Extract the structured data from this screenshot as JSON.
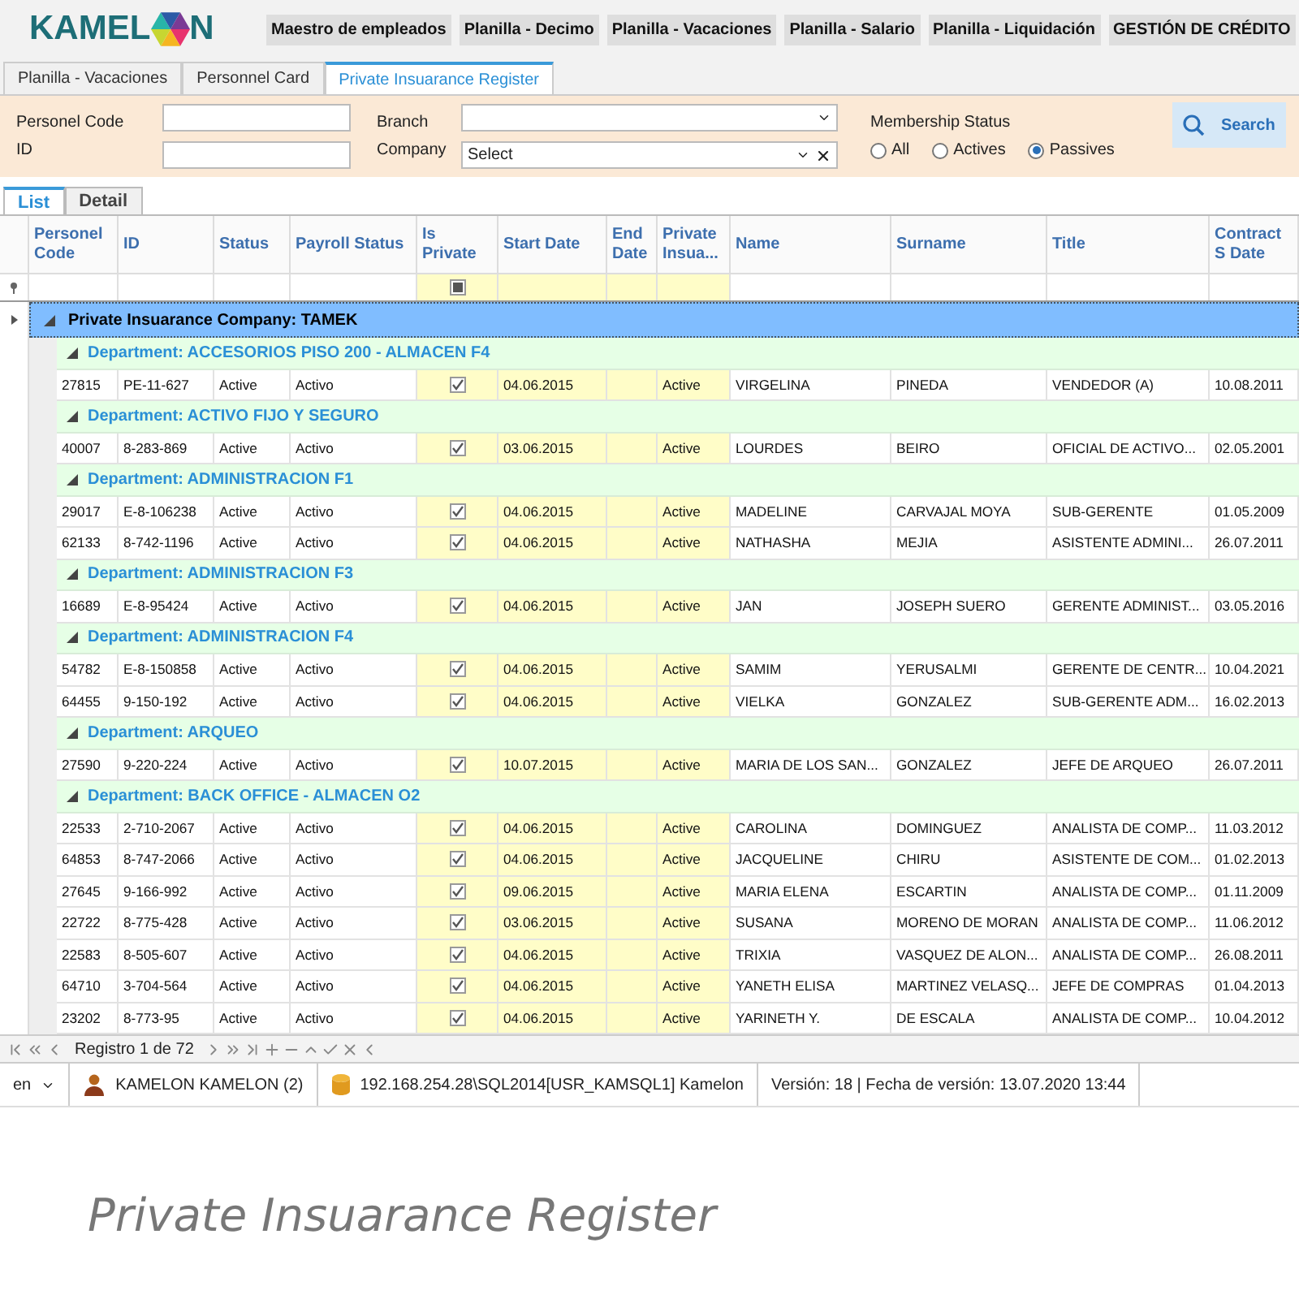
{
  "logo": {
    "text_before": "KAMEL",
    "text_after": "N"
  },
  "main_menu": [
    "Maestro de empleados",
    "Planilla - Decimo",
    "Planilla - Vacaciones",
    "Planilla - Salario",
    "Planilla - Liquidación",
    "GESTIÓN DE CRÉDITO"
  ],
  "document_tabs": [
    {
      "label": "Planilla - Vacaciones",
      "selected": false
    },
    {
      "label": "Personnel Card",
      "selected": false
    },
    {
      "label": "Private Insuarance Register",
      "selected": true
    }
  ],
  "filters": {
    "personel_code_label": "Personel Code",
    "id_label": "ID",
    "branch_label": "Branch",
    "company_label": "Company",
    "company_value": "Select",
    "membership_label": "Membership Status",
    "membership_options": [
      {
        "label": "All",
        "selected": false
      },
      {
        "label": "Actives",
        "selected": false
      },
      {
        "label": "Passives",
        "selected": true
      }
    ],
    "search_button": "Search"
  },
  "view_tabs": [
    {
      "label": "List",
      "selected": true
    },
    {
      "label": "Detail",
      "selected": false
    }
  ],
  "columns": [
    "Personel Code",
    "ID",
    "Status",
    "Payroll Status",
    "Is Private",
    "Start Date",
    "End Date",
    "Private Insua...",
    "Name",
    "Surname",
    "Title",
    "Contract S Date"
  ],
  "is_private_filter": {
    "indeterminate": true
  },
  "company_group": {
    "label": "Private Insuarance Company: TAMEK",
    "expanded": true
  },
  "groups": [
    {
      "label": "Department: ACCESORIOS PISO 200 - ALMACEN F4",
      "expanded": true,
      "rows": [
        {
          "code": "27815",
          "id": "PE-11-627",
          "status": "Active",
          "payroll_status": "Activo",
          "is_private": true,
          "start_date": "04.06.2015",
          "private_insurance": "Active",
          "name": "VIRGELINA",
          "surname": "PINEDA",
          "title": "VENDEDOR (A)",
          "contract_start": "10.08.2011"
        }
      ]
    },
    {
      "label": "Department: ACTIVO FIJO Y SEGURO",
      "expanded": true,
      "rows": [
        {
          "code": "40007",
          "id": "8-283-869",
          "status": "Active",
          "payroll_status": "Activo",
          "is_private": true,
          "start_date": "03.06.2015",
          "private_insurance": "Active",
          "name": "LOURDES",
          "surname": "BEIRO",
          "title": "OFICIAL DE ACTIVO...",
          "contract_start": "02.05.2001"
        }
      ]
    },
    {
      "label": "Department: ADMINISTRACION F1",
      "expanded": true,
      "rows": [
        {
          "code": "29017",
          "id": "E-8-106238",
          "status": "Active",
          "payroll_status": "Activo",
          "is_private": true,
          "start_date": "04.06.2015",
          "private_insurance": "Active",
          "name": "MADELINE",
          "surname": "CARVAJAL MOYA",
          "title": "SUB-GERENTE",
          "contract_start": "01.05.2009"
        },
        {
          "code": "62133",
          "id": "8-742-1196",
          "status": "Active",
          "payroll_status": "Activo",
          "is_private": true,
          "start_date": "04.06.2015",
          "private_insurance": "Active",
          "name": "NATHASHA",
          "surname": "MEJIA",
          "title": "ASISTENTE ADMINI...",
          "contract_start": "26.07.2011"
        }
      ]
    },
    {
      "label": "Department: ADMINISTRACION F3",
      "expanded": true,
      "rows": [
        {
          "code": "16689",
          "id": "E-8-95424",
          "status": "Active",
          "payroll_status": "Activo",
          "is_private": true,
          "start_date": "04.06.2015",
          "private_insurance": "Active",
          "name": "JAN",
          "surname": "JOSEPH SUERO",
          "title": "GERENTE ADMINIST...",
          "contract_start": "03.05.2016"
        }
      ]
    },
    {
      "label": "Department: ADMINISTRACION F4",
      "expanded": true,
      "rows": [
        {
          "code": "54782",
          "id": "E-8-150858",
          "status": "Active",
          "payroll_status": "Activo",
          "is_private": true,
          "start_date": "04.06.2015",
          "private_insurance": "Active",
          "name": "SAMIM",
          "surname": "YERUSALMI",
          "title": "GERENTE DE CENTR...",
          "contract_start": "10.04.2021"
        },
        {
          "code": "64455",
          "id": "9-150-192",
          "status": "Active",
          "payroll_status": "Activo",
          "is_private": true,
          "start_date": "04.06.2015",
          "private_insurance": "Active",
          "name": "VIELKA",
          "surname": "GONZALEZ",
          "title": "SUB-GERENTE ADM...",
          "contract_start": "16.02.2013"
        }
      ]
    },
    {
      "label": "Department: ARQUEO",
      "expanded": true,
      "rows": [
        {
          "code": "27590",
          "id": "9-220-224",
          "status": "Active",
          "payroll_status": "Activo",
          "is_private": true,
          "start_date": "10.07.2015",
          "private_insurance": "Active",
          "name": "MARIA DE LOS SAN...",
          "surname": "GONZALEZ",
          "title": "JEFE DE ARQUEO",
          "contract_start": "26.07.2011"
        }
      ]
    },
    {
      "label": "Department: BACK OFFICE - ALMACEN O2",
      "expanded": true,
      "rows": [
        {
          "code": "22533",
          "id": "2-710-2067",
          "status": "Active",
          "payroll_status": "Activo",
          "is_private": true,
          "start_date": "04.06.2015",
          "private_insurance": "Active",
          "name": "CAROLINA",
          "surname": "DOMINGUEZ",
          "title": "ANALISTA DE COMP...",
          "contract_start": "11.03.2012"
        },
        {
          "code": "64853",
          "id": "8-747-2066",
          "status": "Active",
          "payroll_status": "Activo",
          "is_private": true,
          "start_date": "04.06.2015",
          "private_insurance": "Active",
          "name": "JACQUELINE",
          "surname": "CHIRU",
          "title": "ASISTENTE DE COM...",
          "contract_start": "01.02.2013"
        },
        {
          "code": "27645",
          "id": "9-166-992",
          "status": "Active",
          "payroll_status": "Activo",
          "is_private": true,
          "start_date": "09.06.2015",
          "private_insurance": "Active",
          "name": "MARIA ELENA",
          "surname": "ESCARTIN",
          "title": "ANALISTA DE COMP...",
          "contract_start": "01.11.2009"
        },
        {
          "code": "22722",
          "id": "8-775-428",
          "status": "Active",
          "payroll_status": "Activo",
          "is_private": true,
          "start_date": "03.06.2015",
          "private_insurance": "Active",
          "name": "SUSANA",
          "surname": "MORENO DE MORAN",
          "title": "ANALISTA DE COMP...",
          "contract_start": "11.06.2012"
        },
        {
          "code": "22583",
          "id": "8-505-607",
          "status": "Active",
          "payroll_status": "Activo",
          "is_private": true,
          "start_date": "04.06.2015",
          "private_insurance": "Active",
          "name": "TRIXIA",
          "surname": "VASQUEZ DE ALON...",
          "title": "ANALISTA DE COMP...",
          "contract_start": "26.08.2011"
        },
        {
          "code": "64710",
          "id": "3-704-564",
          "status": "Active",
          "payroll_status": "Activo",
          "is_private": true,
          "start_date": "04.06.2015",
          "private_insurance": "Active",
          "name": "YANETH ELISA",
          "surname": "MARTINEZ VELASQ...",
          "title": "JEFE DE COMPRAS",
          "contract_start": "01.04.2013"
        },
        {
          "code": "23202",
          "id": "8-773-95",
          "status": "Active",
          "payroll_status": "Activo",
          "is_private": true,
          "start_date": "04.06.2015",
          "private_insurance": "Active",
          "name": "YARINETH Y.",
          "surname": "DE ESCALA",
          "title": "ANALISTA DE COMP...",
          "contract_start": "10.04.2012"
        }
      ]
    }
  ],
  "navigator": {
    "record_text": "Registro 1 de 72"
  },
  "status_bar": {
    "language": "en",
    "user": "KAMELON KAMELON (2)",
    "database": "192.168.254.28\\SQL2014[USR_KAMSQL1] Kamelon",
    "version": "Versión: 18 | Fecha de versión: 13.07.2020 13:44"
  },
  "caption": "Private Insuarance Register"
}
